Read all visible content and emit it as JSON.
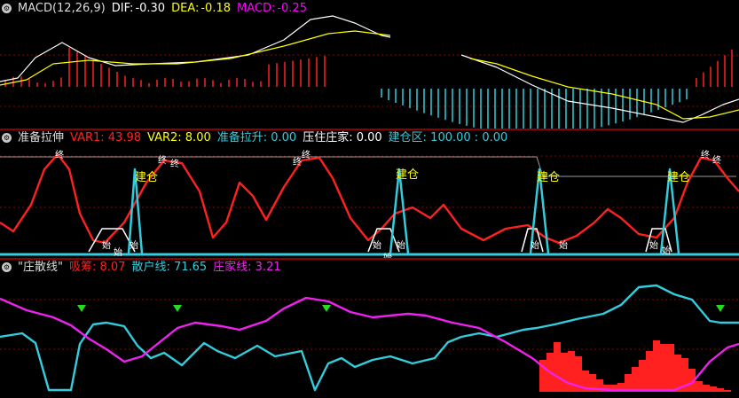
{
  "colors": {
    "bg": "#000000",
    "dif": "#ffffff",
    "dea": "#ffff00",
    "macd": "#ff00ff",
    "red": "#ff2020",
    "cyan": "#33ccdd",
    "white": "#ffffff",
    "gray": "#9a9a9a",
    "green": "#22dd22",
    "magenta": "#ee22ee",
    "yellow": "#ffff00"
  },
  "macd_panel": {
    "icon": "settings-circle-icon",
    "name": "MACD(12,26,9)",
    "dif_label": "DIF:",
    "dif_value": "-0.30",
    "dea_label": "DEA:",
    "dea_value": "-0.18",
    "macd_label": "MACD:",
    "macd_value": "-0.25"
  },
  "zhunbei_panel": {
    "icon": "settings-circle-icon",
    "name": "准备拉伸",
    "var1": "VAR1: 43.98",
    "var2": "VAR2: 8.00",
    "zhunbei": "准备拉升: 0.00",
    "yazhu": "压住庄家: 0.00",
    "jiancang": "建仓区: 100.00 : 0.00",
    "marker_jiancang": "建仓",
    "marker_shi": "始",
    "marker_top": "终"
  },
  "zhuangsan_panel": {
    "icon": "settings-circle-icon",
    "name": "\"庄散线\"",
    "xichou": "吸筹: 8.07",
    "sanhu": "散户线: 71.65",
    "zhuangjia": "庄家线: 3.21"
  }
}
